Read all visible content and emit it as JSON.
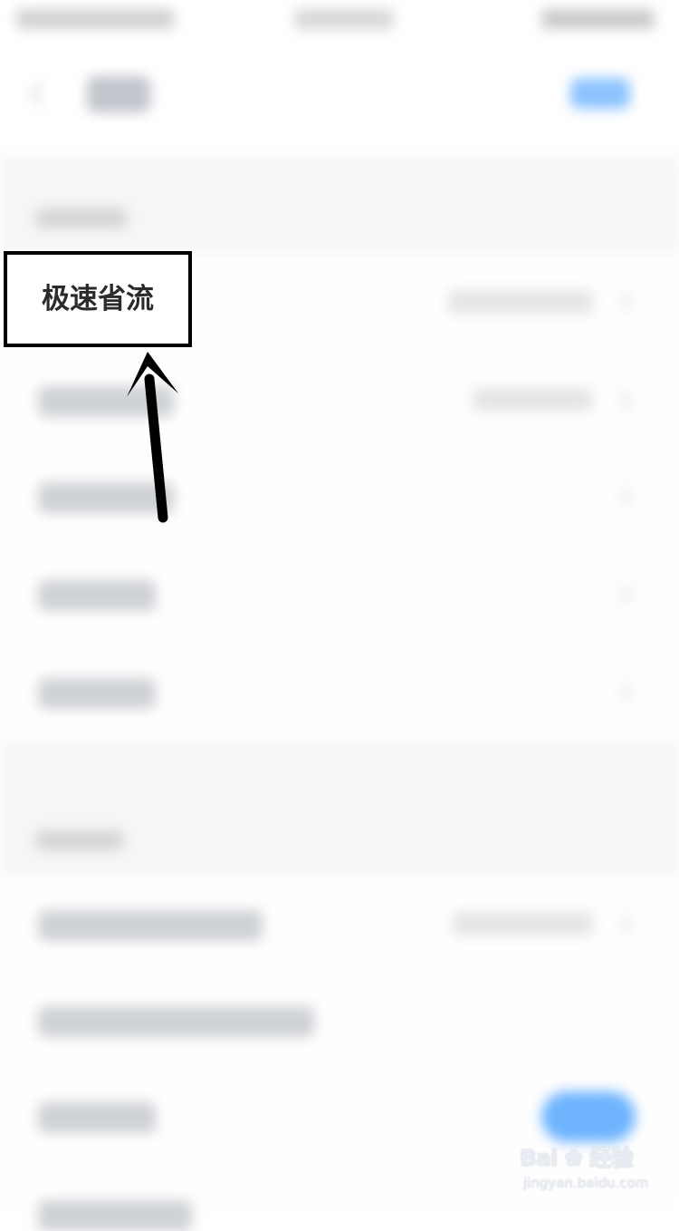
{
  "callout": {
    "text": "极速省流"
  },
  "watermark": {
    "logo": "Bai",
    "logo_suffix": "经验",
    "url": "jingyan.baidu.com"
  },
  "colors": {
    "accent": "#3d9bff",
    "frame": "#000000"
  },
  "icons": [
    "back-icon",
    "chevron-right-icon",
    "paw-icon"
  ]
}
